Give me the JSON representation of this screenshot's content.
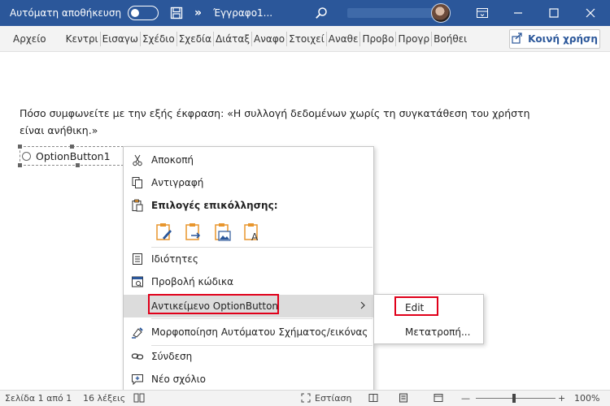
{
  "titlebar": {
    "autosave_label": "Αυτόματη αποθήκευση",
    "doc_title": "Έγγραφο1...",
    "icons": [
      "save-icon",
      "more-icon",
      "search-icon",
      "minimize-icon",
      "restore-icon",
      "close-icon"
    ],
    "color": "#2b579a"
  },
  "ribbon": {
    "tabs": [
      "Αρχείο",
      "Κεντρι",
      "Εισαγω",
      "Σχέδιο",
      "Σχεδία",
      "Διάταξ",
      "Αναφο",
      "Στοιχεί",
      "Αναθε",
      "Προβο",
      "Προγρ",
      "Βοήθει"
    ],
    "share_label": "Κοινή χρήση"
  },
  "document": {
    "question_line1": "Πόσο συμφωνείτε με την εξής έκφραση: «Η συλλογή δεδομένων χωρίς τη συγκατάθεση του χρήστη",
    "question_line2": "είναι ανήθικη.»",
    "option_label": "OptionButton1"
  },
  "context_menu": {
    "cut": "Αποκοπή",
    "copy": "Αντιγραφή",
    "paste_options": "Επιλογές επικόλλησης:",
    "properties": "Ιδιότητες",
    "view_code": "Προβολή κώδικα",
    "object": "Αντικείμενο OptionButton",
    "format": "Μορφοποίηση Αυτόματου Σχήματος/εικόνας",
    "link": "Σύνδεση",
    "comment": "Νέο σχόλιο"
  },
  "submenu": {
    "edit": "Edit",
    "convert": "Μετατροπή..."
  },
  "statusbar": {
    "page": "Σελίδα 1 από 1",
    "words": "16 λέξεις",
    "focus": "Εστίαση",
    "zoom": "100%",
    "zoom_level": 1.0
  },
  "colors": {
    "accent": "#2b579a",
    "highlight_border": "#e0001a",
    "paste_icon": "#e8962d"
  }
}
